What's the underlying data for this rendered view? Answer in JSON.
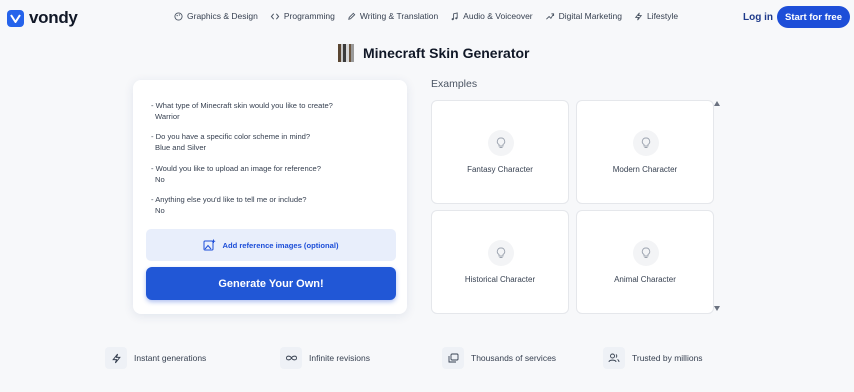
{
  "brand": {
    "name": "vondy"
  },
  "nav": {
    "items": [
      {
        "label": "Graphics & Design",
        "icon": "palette-icon"
      },
      {
        "label": "Programming",
        "icon": "code-icon"
      },
      {
        "label": "Writing & Translation",
        "icon": "pen-icon"
      },
      {
        "label": "Audio & Voiceover",
        "icon": "music-note-icon"
      },
      {
        "label": "Digital Marketing",
        "icon": "trend-icon"
      },
      {
        "label": "Lifestyle",
        "icon": "lightning-icon"
      }
    ],
    "login_label": "Log in",
    "start_label": "Start for free"
  },
  "page": {
    "title": "Minecraft Skin Generator"
  },
  "form": {
    "qa": [
      {
        "question": "- What type of Minecraft skin would you like to create?",
        "answer": "Warrior"
      },
      {
        "question": "- Do you have a specific color scheme in mind?",
        "answer": "Blue and Silver"
      },
      {
        "question": "- Would you like to upload an image for reference?",
        "answer": "No"
      },
      {
        "question": "- Anything else you'd like to tell me or include?",
        "answer": "No"
      }
    ],
    "reference_label": "Add reference images (optional)",
    "generate_label": "Generate Your Own!"
  },
  "examples": {
    "title": "Examples",
    "items": [
      {
        "label": "Fantasy Character"
      },
      {
        "label": "Modern Character"
      },
      {
        "label": "Historical Character"
      },
      {
        "label": "Animal Character"
      }
    ]
  },
  "features": [
    {
      "label": "Instant generations",
      "icon": "lightning-icon"
    },
    {
      "label": "Infinite revisions",
      "icon": "infinity-icon"
    },
    {
      "label": "Thousands of services",
      "icon": "stack-icon"
    },
    {
      "label": "Trusted by millions",
      "icon": "users-icon"
    }
  ],
  "colors": {
    "accent": "#1d4ed8",
    "background": "#f7f8fa",
    "reference_bg": "#e8eefb"
  }
}
